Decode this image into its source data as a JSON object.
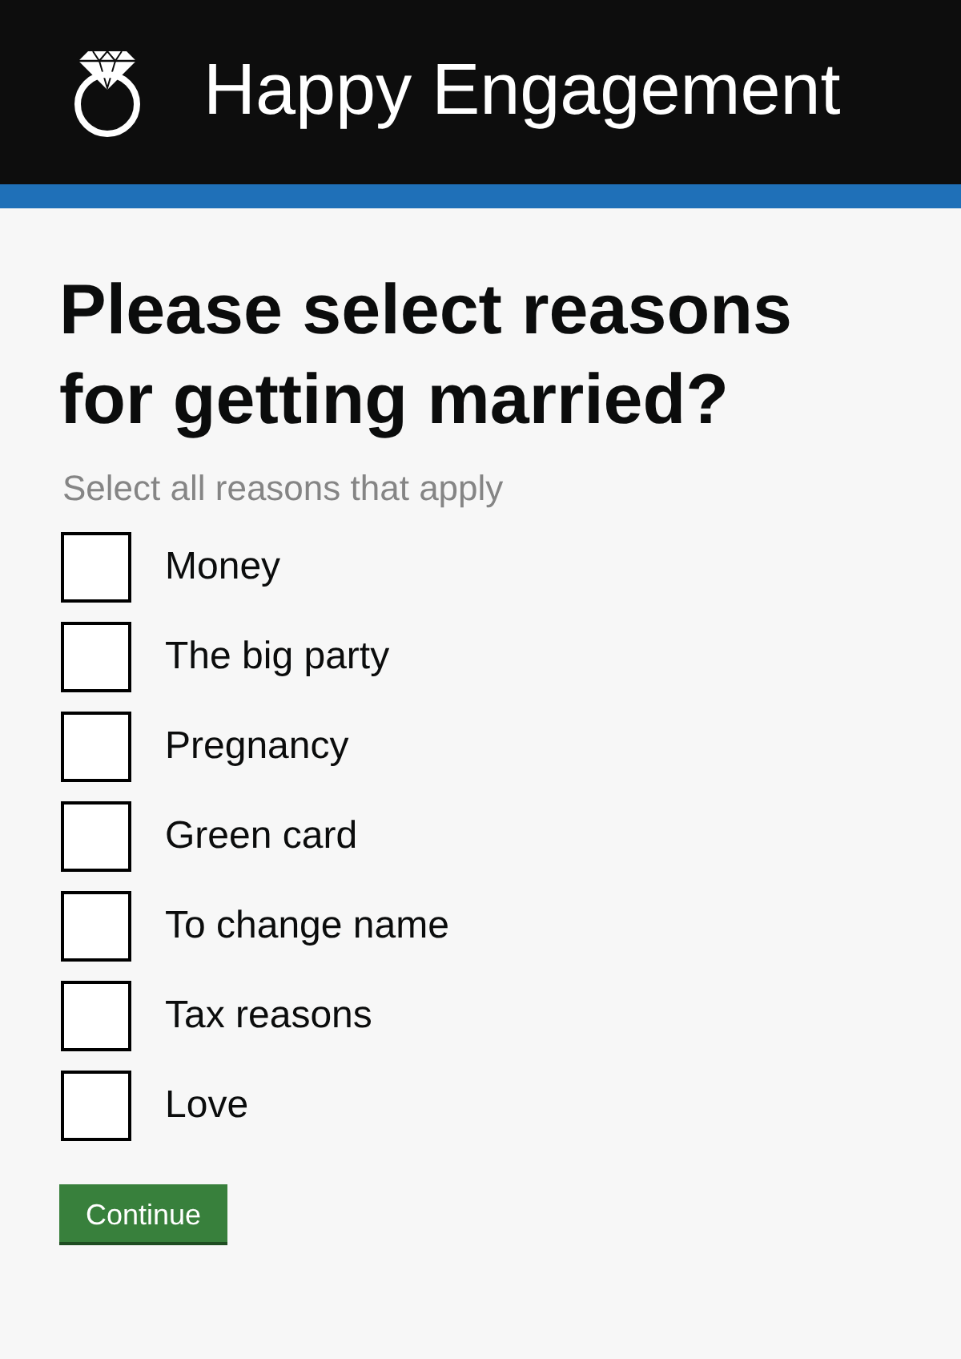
{
  "header": {
    "title": "Happy Engagement"
  },
  "question": {
    "title": "Please select reasons for getting married?",
    "hint": "Select all reasons that apply"
  },
  "options": [
    {
      "label": "Money",
      "checked": false
    },
    {
      "label": "The big party",
      "checked": false
    },
    {
      "label": "Pregnancy",
      "checked": false
    },
    {
      "label": "Green card",
      "checked": false
    },
    {
      "label": "To change name",
      "checked": false
    },
    {
      "label": "Tax reasons",
      "checked": false
    },
    {
      "label": "Love",
      "checked": false
    }
  ],
  "buttons": [
    {
      "label": "Continue",
      "kind": "primary"
    }
  ]
}
